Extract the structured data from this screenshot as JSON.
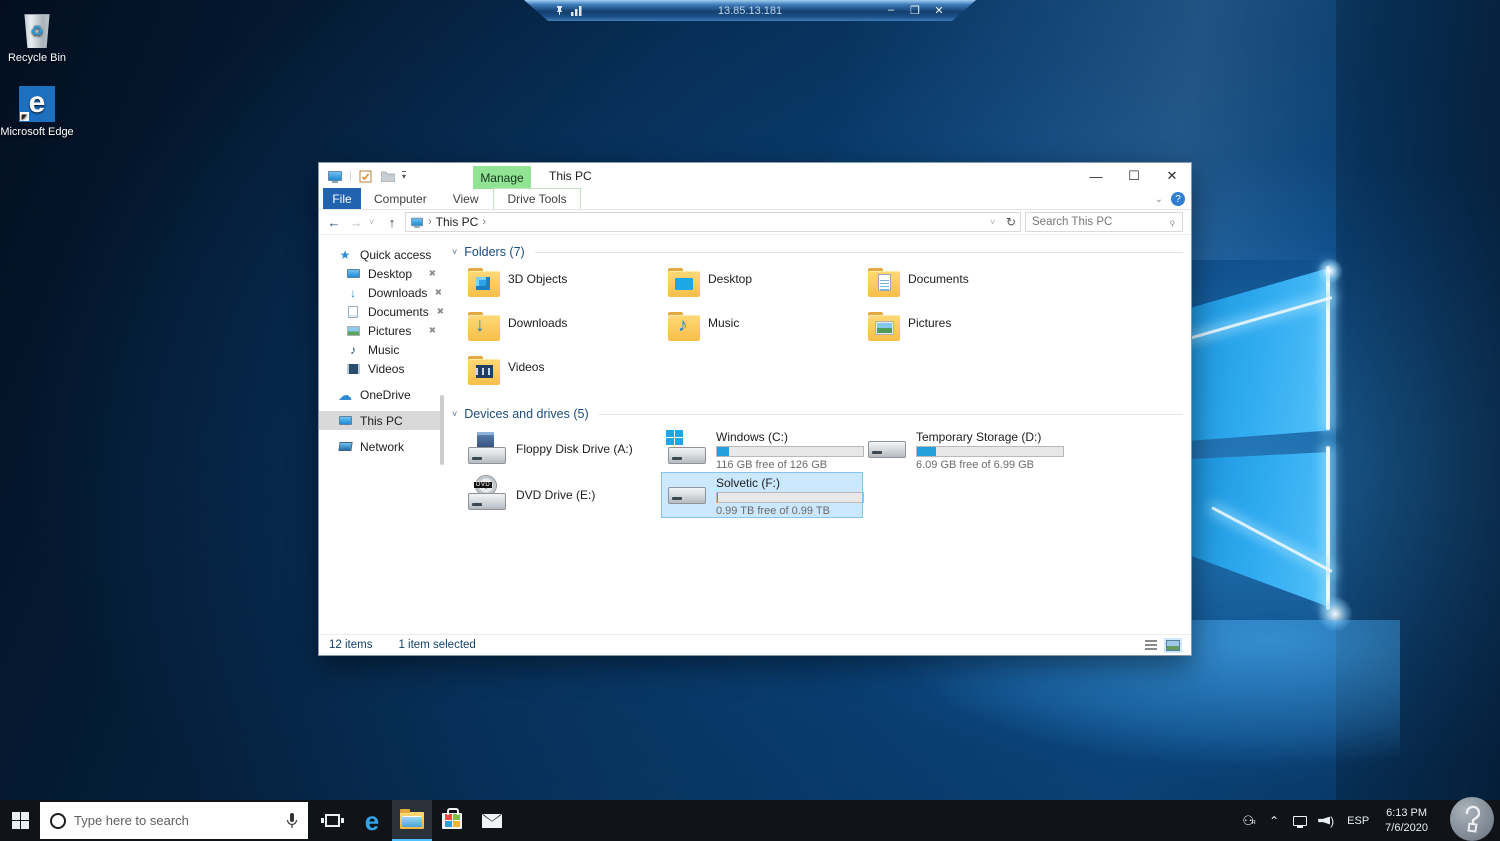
{
  "rdp_bar": {
    "title": "13.85.13.181",
    "minimize": "–",
    "restore": "❐",
    "close": "✕"
  },
  "desktop_icons": {
    "recycle_bin": "Recycle Bin",
    "edge": "Microsoft Edge"
  },
  "explorer": {
    "title": "This PC",
    "contextual_group": "Manage",
    "tabs": {
      "file": "File",
      "computer": "Computer",
      "view": "View",
      "drive_tools": "Drive Tools"
    },
    "address": {
      "breadcrumb": "This PC",
      "search_placeholder": "Search This PC"
    },
    "sidebar": {
      "quick_access": "Quick access",
      "items": [
        {
          "label": "Desktop"
        },
        {
          "label": "Downloads"
        },
        {
          "label": "Documents"
        },
        {
          "label": "Pictures"
        },
        {
          "label": "Music"
        },
        {
          "label": "Videos"
        }
      ],
      "onedrive": "OneDrive",
      "this_pc": "This PC",
      "network": "Network"
    },
    "groups": {
      "folders": {
        "label": "Folders (7)",
        "items": [
          "3D Objects",
          "Desktop",
          "Documents",
          "Downloads",
          "Music",
          "Pictures",
          "Videos"
        ]
      },
      "drives": {
        "label": "Devices and drives (5)",
        "items": [
          {
            "name": "Floppy Disk Drive (A:)",
            "free": "",
            "used_pct": 0
          },
          {
            "name": "Windows (C:)",
            "free": "116 GB free of 126 GB",
            "used_pct": 8
          },
          {
            "name": "Temporary Storage (D:)",
            "free": "6.09 GB free of 6.99 GB",
            "used_pct": 13
          },
          {
            "name": "DVD Drive (E:)",
            "free": "",
            "used_pct": 0
          },
          {
            "name": "Solvetic (F:)",
            "free": "0.99 TB free of 0.99 TB",
            "used_pct": 1
          }
        ]
      }
    },
    "status": {
      "items": "12 items",
      "selected": "1 item selected"
    }
  },
  "taskbar": {
    "search_placeholder": "Type here to search",
    "tray": {
      "lang": "ESP",
      "time": "6:13 PM",
      "date": "7/6/2020"
    }
  },
  "colors": {
    "accent": "#0078d7",
    "selection_bg": "#cce8ff",
    "selection_border": "#84c5f0",
    "manage_green": "#90e493",
    "meter_fill": "#26a0da"
  }
}
